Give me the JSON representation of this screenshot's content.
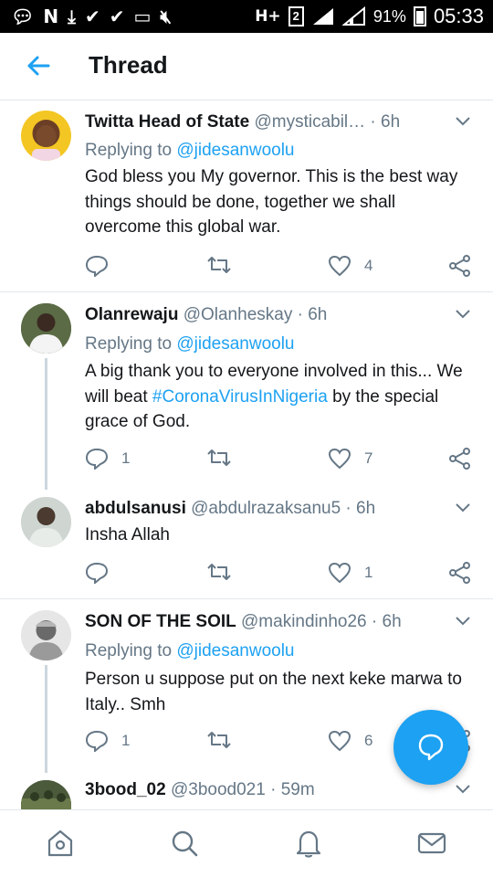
{
  "status_bar": {
    "network": "H+",
    "sim": "2",
    "battery": "91%",
    "time": "05:33"
  },
  "header": {
    "title": "Thread"
  },
  "tweets": [
    {
      "name": "Twitta Head of State",
      "handle": "@mysticabil…",
      "sep": " · ",
      "time": "6h",
      "reply_prefix": "Replying to ",
      "reply_to": "@jidesanwoolu",
      "text": "God bless you My governor. This is the best way things should be done, together we shall overcome this global war.",
      "replies": "",
      "likes": "4"
    },
    {
      "name": "Olanrewaju",
      "handle": "@Olanheskay",
      "sep": " · ",
      "time": "6h",
      "reply_prefix": "Replying to ",
      "reply_to": "@jidesanwoolu",
      "text_before": "A big thank you to everyone involved in this... We will beat ",
      "hashtag": "#CoronaVirusInNigeria",
      "text_after": " by the special grace of God.",
      "replies": "1",
      "likes": "7"
    },
    {
      "name": "abdulsanusi",
      "handle": "@abdulrazaksanu5",
      "sep": " · ",
      "time": "6h",
      "text": "Insha Allah",
      "replies": "",
      "likes": "1"
    },
    {
      "name": "SON OF THE SOIL",
      "handle": "@makindinho26",
      "sep": " · ",
      "time": "6h",
      "reply_prefix": "Replying to ",
      "reply_to": "@jidesanwoolu",
      "text": "Person u suppose put on the next keke marwa to Italy.. Smh",
      "replies": "1",
      "likes": "6"
    },
    {
      "name": "3bood_02",
      "handle": "@3bood021",
      "sep": " · ",
      "time": "59m"
    }
  ],
  "colors": {
    "accent": "#1da1f2",
    "muted": "#657786",
    "text": "#14171a",
    "divider": "#e1e8ed"
  }
}
